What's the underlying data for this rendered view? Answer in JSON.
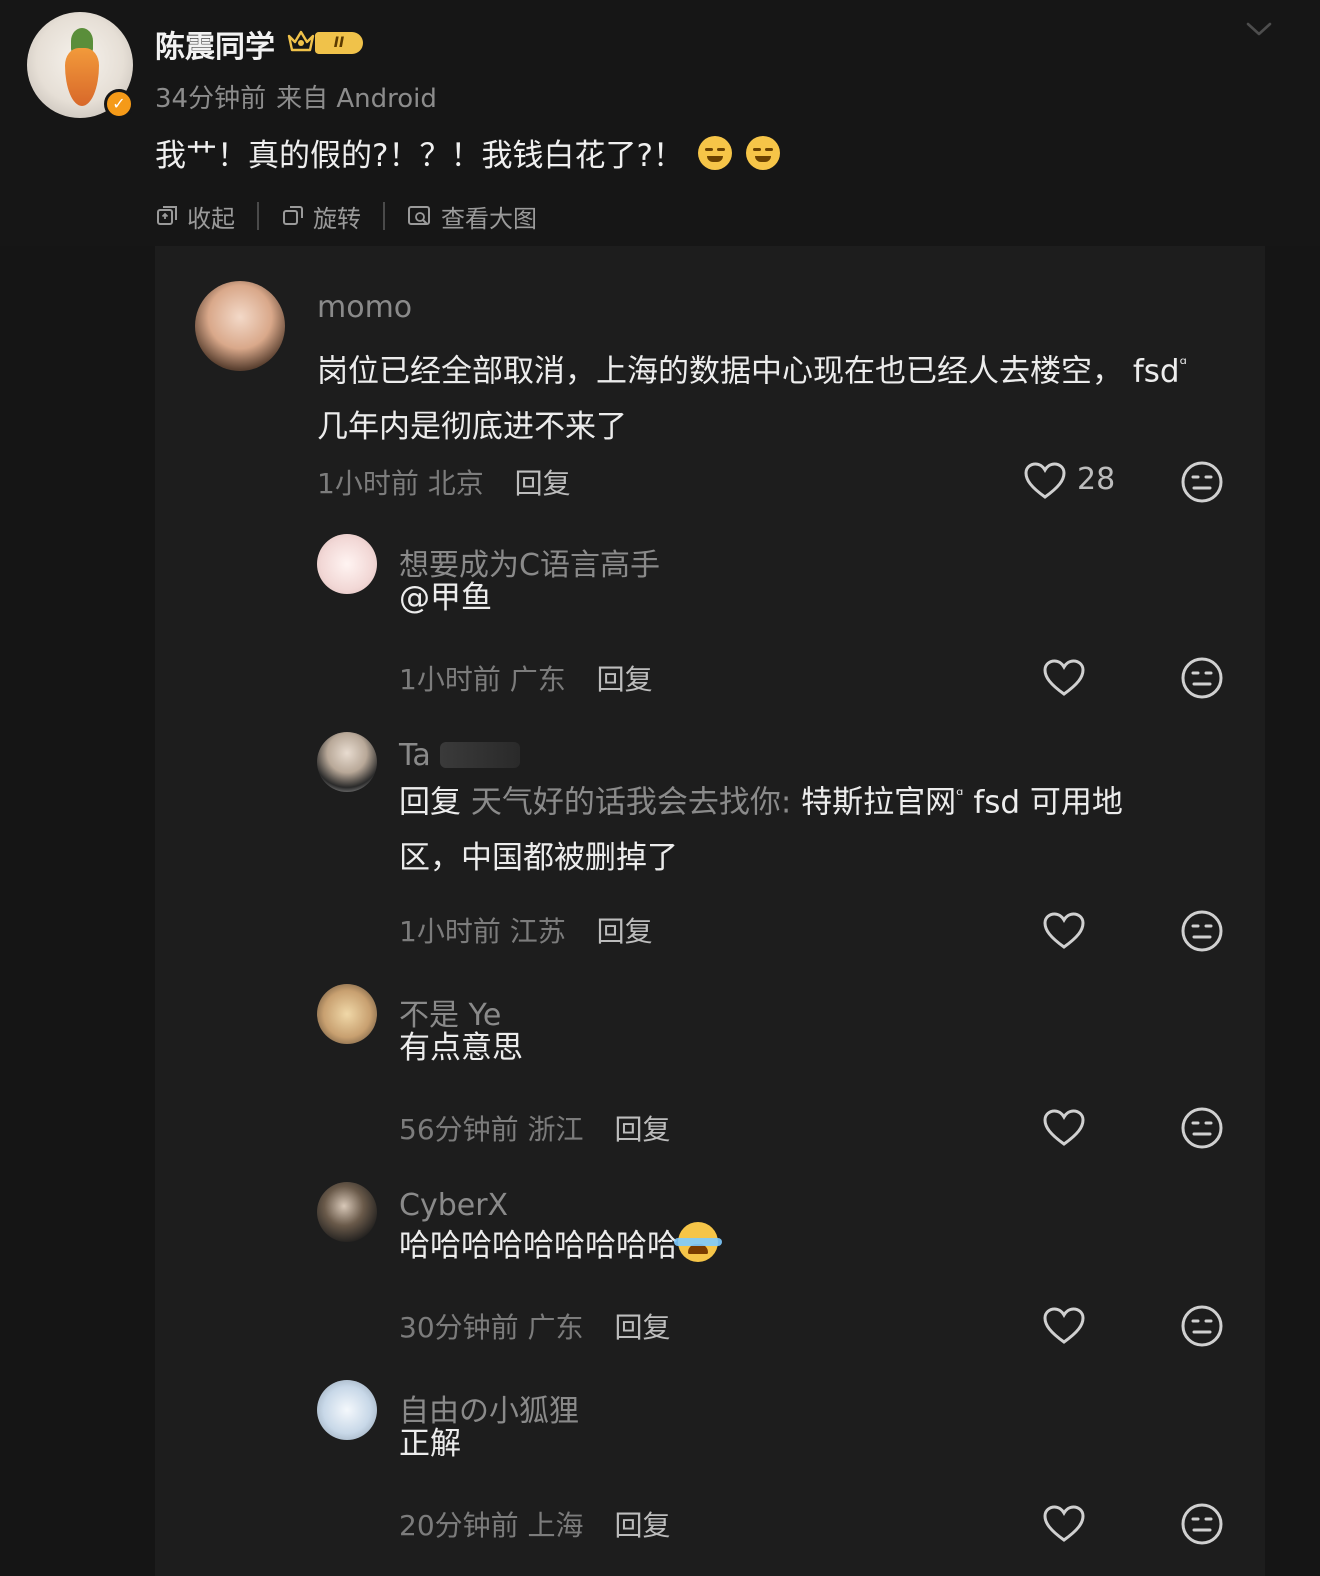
{
  "post": {
    "author": "陈震同学",
    "level": "II",
    "time": "34分钟前",
    "source": "来自 Android",
    "text": "我艹！真的假的?！？！我钱白花了?！",
    "emoji_icons": [
      "grimace-emoji-icon",
      "grimace-emoji-icon"
    ],
    "toolbar": {
      "collapse": "收起",
      "rotate": "旋转",
      "view_large": "查看大图"
    },
    "colors": {
      "background": "#151515",
      "panel": "#1d1d1d",
      "badge_orange": "#f59a18",
      "level_gold": "#f0c24a"
    }
  },
  "comments": [
    {
      "name": "momo",
      "text": "岗位已经全部取消，上海的数据中心现在也已经人去楼空， fsd",
      "text_cont": "几年内是彻底进不来了",
      "time": "1小时前",
      "location": "北京",
      "reply": "回复",
      "likes": "28"
    },
    {
      "name": "想要成为C语言高手",
      "text": "@甲鱼",
      "time": "1小时前",
      "location": "广东",
      "reply": "回复"
    },
    {
      "name": "Ta",
      "reply_prefix": "回复",
      "reply_to": "天气好的话我会去找你:",
      "text": "特斯拉官网",
      "text_mid": "fsd 可用地",
      "text_line2": "区，中国都被删掉了",
      "time": "1小时前",
      "location": "江苏",
      "reply": "回复"
    },
    {
      "name": "不是 Ye",
      "text": "有点意思",
      "time": "56分钟前",
      "location": "浙江",
      "reply": "回复"
    },
    {
      "name": "CyberX",
      "text": "哈哈哈哈哈哈哈哈哈",
      "time": "30分钟前",
      "location": "广东",
      "reply": "回复"
    },
    {
      "name": "自由の小狐狸",
      "text": "正解",
      "time": "20分钟前",
      "location": "上海",
      "reply": "回复"
    }
  ]
}
